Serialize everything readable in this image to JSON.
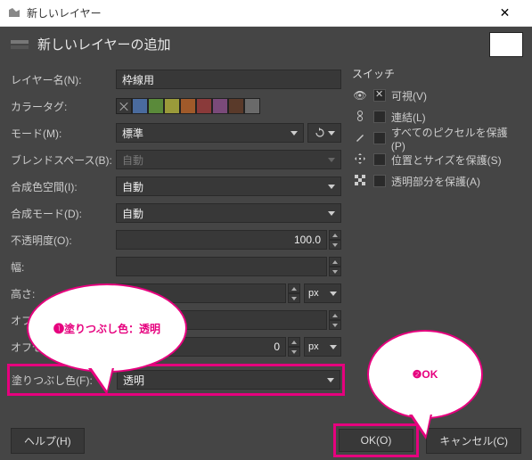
{
  "titlebar": {
    "title": "新しいレイヤー"
  },
  "header": {
    "title": "新しいレイヤーの追加"
  },
  "form": {
    "layer_name_label": "レイヤー名(N):",
    "layer_name_value": "枠線用",
    "color_tag_label": "カラータグ:",
    "mode_label": "モード(M):",
    "mode_value": "標準",
    "blend_space_label": "ブレンドスペース(B):",
    "blend_space_value": "自動",
    "composite_space_label": "合成色空間(I):",
    "composite_space_value": "自動",
    "composite_mode_label": "合成モード(D):",
    "composite_mode_value": "自動",
    "opacity_label": "不透明度(O):",
    "opacity_value": "100.0",
    "width_label": "幅:",
    "height_label": "高さ:",
    "offset_x_label": "オフセット X:",
    "offset_y_label": "オフセット Y:",
    "offset_y_value": "0",
    "unit_px": "px",
    "fill_label": "塗りつぶし色(F):",
    "fill_value": "透明"
  },
  "switches": {
    "title": "スイッチ",
    "visible": "可視(V)",
    "linked": "連結(L)",
    "protect_pixels": "すべてのピクセルを保護(P)",
    "protect_pos": "位置とサイズを保護(S)",
    "protect_alpha": "透明部分を保護(A)"
  },
  "footer": {
    "help": "ヘルプ(H)",
    "ok": "OK(O)",
    "cancel": "キャンセル(C)"
  },
  "callouts": {
    "c1": "❶塗りつぶし色：透明",
    "c2": "❷OK"
  },
  "colors": [
    "#383838",
    "#4a6b9e",
    "#5a8a3a",
    "#9a9a3a",
    "#a05a2a",
    "#8a3a3a",
    "#7a4a7a",
    "#5a3a2a",
    "#6a6a6a"
  ]
}
